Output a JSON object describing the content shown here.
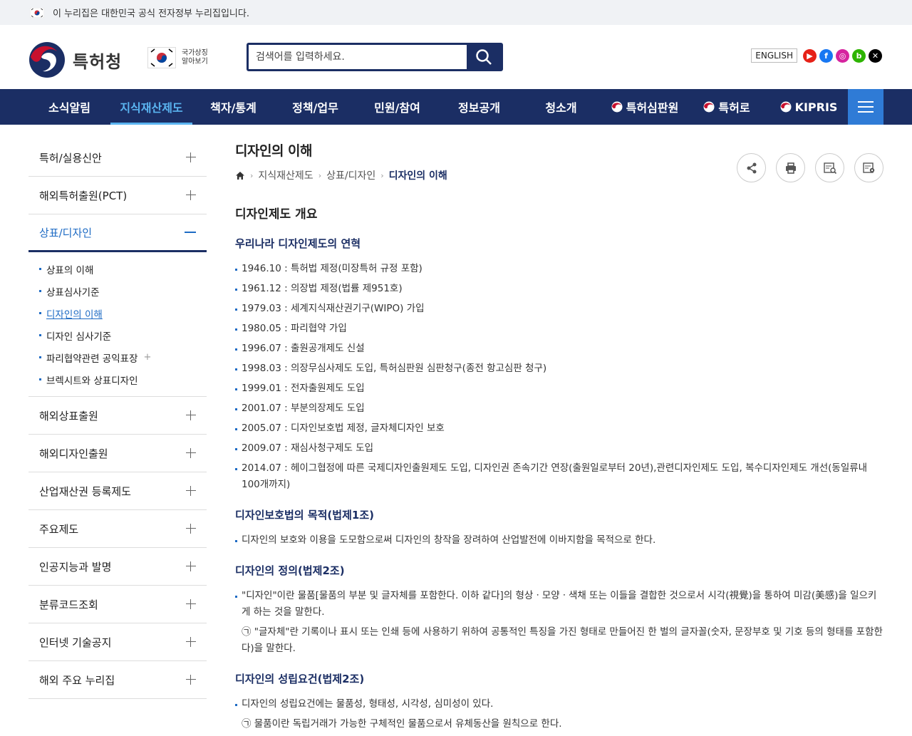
{
  "gov_banner": {
    "text": "이 누리집은 대한민국 공식 전자정부 누리집입니다."
  },
  "header": {
    "org_name": "특허청",
    "symbol_text_1": "국가상징",
    "symbol_text_2": "알아보기",
    "search_placeholder": "검색어를 입력하세요.",
    "english": "ENGLISH"
  },
  "gnb": {
    "items": [
      "소식알림",
      "지식재산제도",
      "책자/통계",
      "정책/업무",
      "민원/참여",
      "정보공개",
      "청소개",
      "특허심판원",
      "특허로",
      "KIPRIS"
    ]
  },
  "sidebar": {
    "groups_top": [
      "특허/실용신안",
      "해외특허출원(PCT)"
    ],
    "open_group": "상표/디자인",
    "sub_items": [
      "상표의 이해",
      "상표심사기준",
      "디자인의 이해",
      "디자인 심사기준",
      "파리협약관련 공익표장",
      "브렉시트와 상표디자인"
    ],
    "groups_bottom": [
      "해외상표출원",
      "해외디자인출원",
      "산업재산권 등록제도",
      "주요제도",
      "인공지능과 발명",
      "분류코드조회",
      "인터넷 기술공지",
      "해외 주요 누리집"
    ]
  },
  "content": {
    "title": "디자인의 이해",
    "breadcrumb": [
      "지식재산제도",
      "상표/디자인",
      "디자인의 이해"
    ],
    "h2": "디자인제도 개요",
    "sec1_title": "우리나라 디자인제도의 연혁",
    "history": [
      "1946.10 : 특허법 제정(미장특허 규정 포함)",
      "1961.12 : 의장법 제정(법률 제951호)",
      "1979.03 : 세계지식재산권기구(WIPO) 가입",
      "1980.05 : 파리협약 가입",
      "1996.07 : 출원공개제도 신설",
      "1998.03 : 의장무심사제도 도입, 특허심판원 심판청구(종전 항고심판 청구)",
      "1999.01 : 전자출원제도 도입",
      "2001.07 : 부분의장제도 도입",
      "2005.07 : 디자인보호법 제정, 글자체디자인 보호",
      "2009.07 : 재심사청구제도 도입",
      "2014.07 : 헤이그협정에 따른 국제디자인출원제도 도입, 디자인권 존속기간 연장(출원일로부터 20년),관련디자인제도 도입, 복수디자인제도 개선(동일류내 100개까지)"
    ],
    "sec2_title": "디자인보호법의 목적(법제1조)",
    "sec2_text": "디자인의 보호와 이용을 도모함으로써 디자인의 창작을 장려하여 산업발전에 이바지함을 목적으로 한다.",
    "sec3_title": "디자인의 정의(법제2조)",
    "sec3_text": "\"디자인\"이란 물품[물품의 부분 및 글자체를 포함한다. 이하 같다]의 형상ㆍ모양ㆍ색채 또는 이들을 결합한 것으로서 시각(視覺)을 통하여 미감(美感)을 일으키게 하는 것을 말한다.",
    "sec3_note": "㉠ \"글자체\"란 기록이나 표시 또는 인쇄 등에 사용하기 위하여 공통적인 특징을 가진 형태로 만들어진 한 벌의 글자꼴(숫자, 문장부호 및 기호 등의 형태를 포함한다)을 말한다.",
    "sec4_title": "디자인의 성립요건(법제2조)",
    "sec4_text": "디자인의 성립요건에는 물품성, 형태성, 시각성, 심미성이 있다.",
    "sec4_note": "㉠ 물품이란 독립거래가 가능한 구체적인 물품으로서 유체동산을 원칙으로 한다."
  },
  "colors": {
    "navy": "#1b2e64",
    "accent": "#5ab4f0",
    "link": "#1e6bc4"
  }
}
